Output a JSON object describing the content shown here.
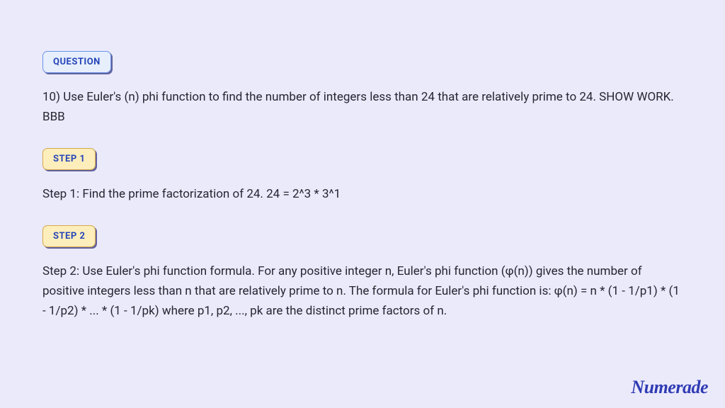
{
  "badges": {
    "question": "QUESTION",
    "step1": "STEP 1",
    "step2": "STEP 2"
  },
  "question_text": "10) Use Euler's (n) phi function to find the number of integers less than 24 that are relatively prime to 24. SHOW WORK. BBB",
  "step1_text": "Step 1: Find the prime factorization of 24. 24 = 2^3 * 3^1",
  "step2_text": "Step 2: Use Euler's phi function formula. For any positive integer n, Euler's phi function (φ(n)) gives the number of positive integers less than n that are relatively prime to n. The formula for Euler's phi function is: φ(n) = n * (1 - 1/p1) * (1 - 1/p2) * ... * (1 - 1/pk) where p1, p2, ..., pk are the distinct prime factors of n.",
  "logo": "Numerade"
}
